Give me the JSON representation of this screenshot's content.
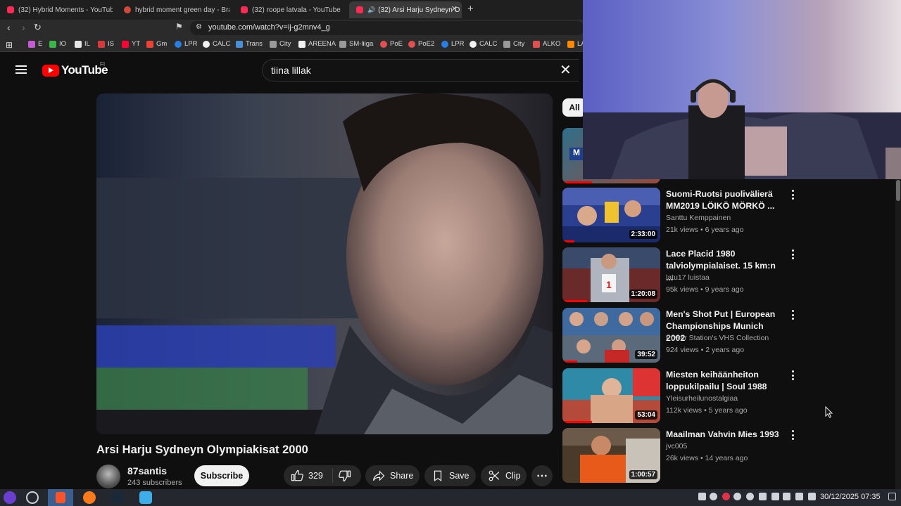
{
  "browser": {
    "tabs": [
      {
        "title": "(32) Hybrid Moments - YouTube",
        "active": false
      },
      {
        "title": "hybrid moment green day - Bra",
        "active": false
      },
      {
        "title": "(32) roope latvala - YouTube",
        "active": false
      },
      {
        "title": "(32) Arsi Harju Sydneyn O",
        "active": true
      }
    ],
    "url": "youtube.com/watch?v=ij-g2mnv4_g",
    "bookmarks": [
      "E",
      "IO",
      "IL",
      "IS",
      "YT",
      "Gm",
      "LPR",
      "CALC",
      "Trans",
      "City",
      "AREENA",
      "SM-liiga",
      "PoE",
      "PoE2",
      "LPR",
      "CALC",
      "City",
      "ALKO",
      "LA"
    ]
  },
  "youtube": {
    "logo_text": "YouTube",
    "country_code": "FI",
    "search_query": "tiina lillak",
    "video": {
      "title": "Arsi Harju Sydneyn Olympiakisat 2000",
      "channel": "87santis",
      "subscribers": "243 subscribers",
      "subscribe_label": "Subscribe",
      "likes": "329",
      "share_label": "Share",
      "save_label": "Save",
      "clip_label": "Clip"
    },
    "chip_all": "All",
    "recommendations": [
      {
        "title": "Suomi-Ruotsi puolivälierä MM2019 LÖIKÖ MÖRKÖ ...",
        "channel": "Santtu Kemppainen",
        "meta": "21k views • 6 years ago",
        "duration": "2:33:00",
        "progress": 0.12
      },
      {
        "title": "Lace Placid 1980 talviolympialaiset. 15 km:n ...",
        "channel": "latu17 luistaa",
        "meta": "95k views • 9 years ago",
        "duration": "1:20:08",
        "progress": 0.25
      },
      {
        "title": "Men's Shot Put | European Championships Munich 2002",
        "channel": "Power Station's VHS Collection",
        "meta": "924 views • 2 years ago",
        "duration": "39:52",
        "progress": 0.15
      },
      {
        "title": "Miesten keihäänheiton loppukilpailu | Soul 1988",
        "channel": "Yleisurheilunostalgiaa",
        "meta": "112k views • 5 years ago",
        "duration": "53:04",
        "progress": 0.3
      },
      {
        "title": "Maailman Vahvin Mies 1993",
        "channel": "jvc005",
        "meta": "26k views • 14 years ago",
        "duration": "1:00:57",
        "progress": 0.0
      }
    ]
  },
  "taskbar": {
    "clock": "30/12/2025 07:35"
  }
}
